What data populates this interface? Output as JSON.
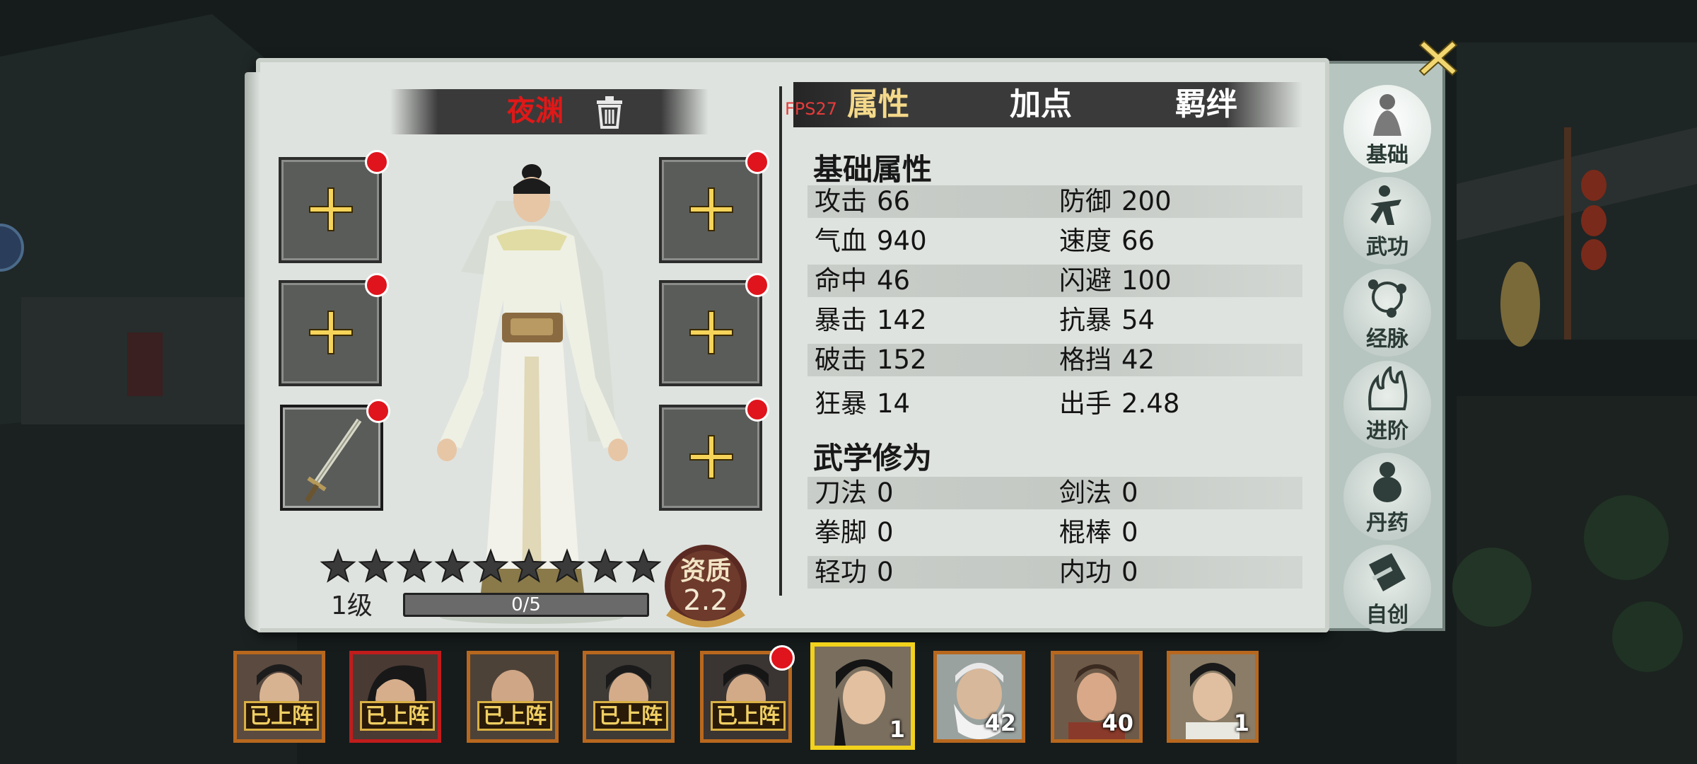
{
  "character": {
    "name": "夜渊",
    "level_label": "1级",
    "exp_text": "0/5",
    "exp_progress": 0,
    "stars_total": 9,
    "stars_filled": 0,
    "aptitude_label": "资质",
    "aptitude_value": "2.2"
  },
  "equipment_slots": [
    {
      "side": "left",
      "item": "empty",
      "has_alert": true
    },
    {
      "side": "left",
      "item": "empty",
      "has_alert": true
    },
    {
      "side": "left",
      "item": "sword",
      "has_alert": true
    },
    {
      "side": "right",
      "item": "empty",
      "has_alert": true
    },
    {
      "side": "right",
      "item": "empty",
      "has_alert": true
    },
    {
      "side": "right",
      "item": "empty",
      "has_alert": true
    }
  ],
  "tabs": [
    "属性",
    "加点",
    "羁绊"
  ],
  "active_tab": "属性",
  "fps_text": "FPS27",
  "basic_attrs": {
    "title": "基础属性",
    "rows": [
      [
        {
          "label": "攻击",
          "value": "66"
        },
        {
          "label": "防御",
          "value": "200"
        }
      ],
      [
        {
          "label": "气血",
          "value": "940"
        },
        {
          "label": "速度",
          "value": "66"
        }
      ],
      [
        {
          "label": "命中",
          "value": "46"
        },
        {
          "label": "闪避",
          "value": "100"
        }
      ],
      [
        {
          "label": "暴击",
          "value": "142"
        },
        {
          "label": "抗暴",
          "value": "54"
        }
      ],
      [
        {
          "label": "破击",
          "value": "152"
        },
        {
          "label": "格挡",
          "value": "42"
        }
      ],
      [
        {
          "label": "狂暴",
          "value": "14"
        },
        {
          "label": "出手",
          "value": "2.48"
        }
      ]
    ]
  },
  "martial_attrs": {
    "title": "武学修为",
    "rows": [
      [
        {
          "label": "刀法",
          "value": "0"
        },
        {
          "label": "剑法",
          "value": "0"
        }
      ],
      [
        {
          "label": "拳脚",
          "value": "0"
        },
        {
          "label": "棍棒",
          "value": "0"
        }
      ],
      [
        {
          "label": "轻功",
          "value": "0"
        },
        {
          "label": "内功",
          "value": "0"
        }
      ]
    ]
  },
  "side_menu": [
    {
      "label": "基础",
      "active": true,
      "icon": "scholar-icon"
    },
    {
      "label": "武功",
      "active": false,
      "icon": "kungfu-icon"
    },
    {
      "label": "经脉",
      "active": false,
      "icon": "meridian-icon"
    },
    {
      "label": "进阶",
      "active": false,
      "icon": "flame-icon"
    },
    {
      "label": "丹药",
      "active": false,
      "icon": "gourd-icon"
    },
    {
      "label": "自创",
      "active": false,
      "icon": "scroll-icon"
    }
  ],
  "roster": [
    {
      "status": "已上阵",
      "level": "",
      "selected": false,
      "alert": false
    },
    {
      "status": "已上阵",
      "level": "",
      "selected": false,
      "alert": false
    },
    {
      "status": "已上阵",
      "level": "",
      "selected": false,
      "alert": false
    },
    {
      "status": "已上阵",
      "level": "",
      "selected": false,
      "alert": false
    },
    {
      "status": "已上阵",
      "level": "",
      "selected": false,
      "alert": true
    },
    {
      "status": "",
      "level": "1",
      "selected": true,
      "alert": false
    },
    {
      "status": "",
      "level": "42",
      "selected": false,
      "alert": false
    },
    {
      "status": "",
      "level": "40",
      "selected": false,
      "alert": false
    },
    {
      "status": "",
      "level": "1",
      "selected": false,
      "alert": false
    }
  ],
  "colors": {
    "name_red": "#e01818",
    "tab_active": "#f4d98a",
    "alert_red": "#e0141c",
    "portrait_border": "#b8681e",
    "selected_border": "#f2d21c"
  }
}
